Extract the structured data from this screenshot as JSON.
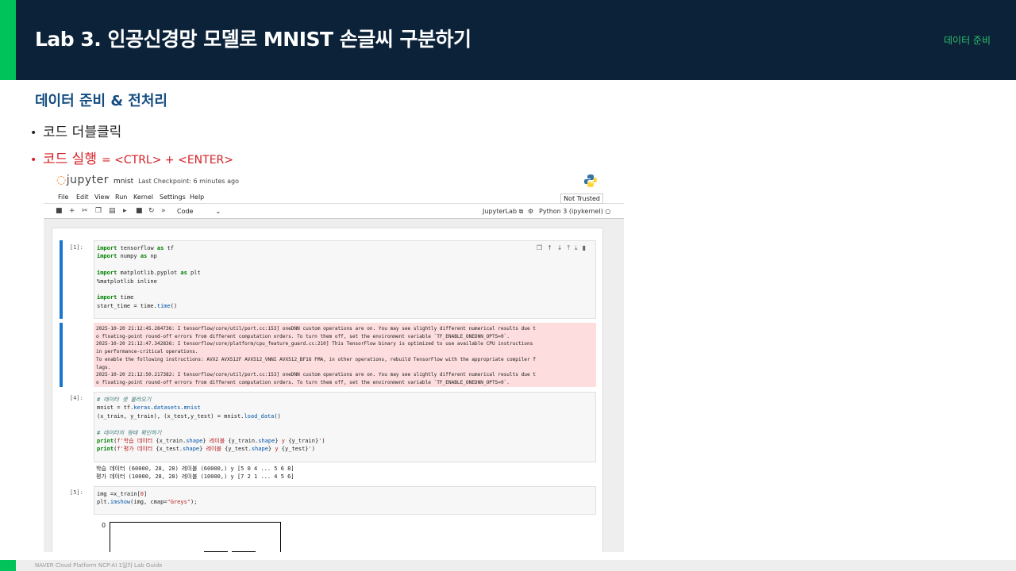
{
  "header": {
    "title": "Lab 3. 인공신경망 모델로 MNIST 손글씨 구분하기",
    "tag": "데이터 준비"
  },
  "section_title": "데이터 준비 & 전처리",
  "bullets": [
    {
      "text": "코드 더블클릭",
      "extra": ""
    },
    {
      "text": "코드 실행",
      "extra": "= <CTRL> + <ENTER>"
    }
  ],
  "jupyter": {
    "logo": "jupyter",
    "notebook_name": "mnist",
    "checkpoint": "Last Checkpoint: 6 minutes ago",
    "menu": [
      "File",
      "Edit",
      "View",
      "Run",
      "Kernel",
      "Settings",
      "Help"
    ],
    "trust": "Not Trusted",
    "cell_type": "Code",
    "lab_link": "JupyterLab",
    "kernel": "Python 3 (ipykernel)",
    "cells": [
      {
        "prompt": "[1]:"
      },
      {
        "prompt": "[4]:"
      },
      {
        "prompt": "[5]:"
      }
    ],
    "stderr": [
      "2025-10-20 21:12:45.284736: I tensorflow/core/util/port.cc:153] oneDNN custom operations are on. You may see slightly different numerical results due t",
      "o floating-point round-off errors from different computation orders. To turn them off, set the environment variable `TF_ENABLE_ONEDNN_OPTS=0`.",
      "2025-10-20 21:12:47.342836: I tensorflow/core/platform/cpu_feature_guard.cc:210] This TensorFlow binary is optimized to use available CPU instructions",
      "in performance-critical operations.",
      "To enable the following instructions: AVX2 AVX512F AVX512_VNNI AVX512_BF16 FMA, in other operations, rebuild TensorFlow with the appropriate compiler f",
      "lags.",
      "2025-10-20 21:12:50.217382: I tensorflow/core/util/port.cc:153] oneDNN custom operations are on. You may see slightly different numerical results due t",
      "o floating-point round-off errors from different computation orders. To turn them off, set the environment variable `TF_ENABLE_ONEDNN_OPTS=0`."
    ],
    "stdout": [
      "학습 데이터 (60000, 28, 28) 레이블 (60000,) y [5 0 4 ... 5 6 8]",
      "평가 데이터 (10000, 28, 28) 레이블 (10000,) y [7 2 1 ... 4 5 6]"
    ],
    "plot_tick": "0"
  },
  "footer": "NAVER Cloud Platform  NCP-AI 1일차 Lab Guide"
}
